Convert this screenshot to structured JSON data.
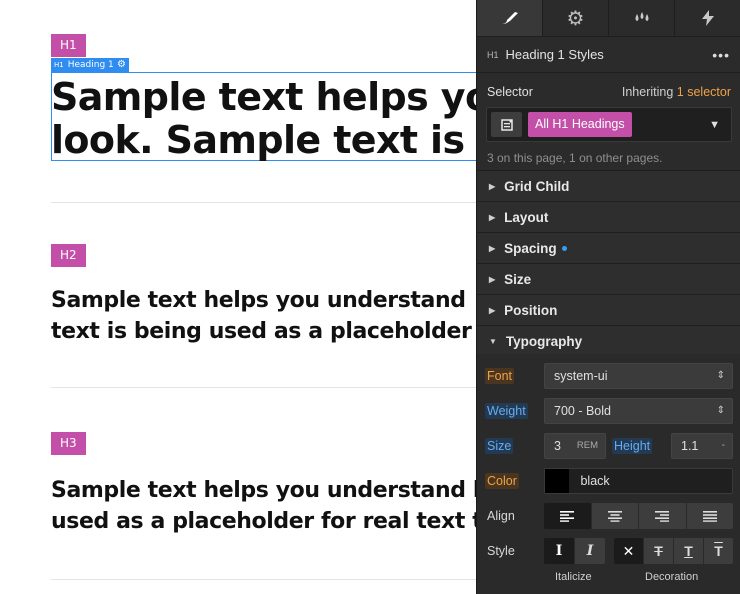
{
  "canvas": {
    "h1_tag": "H1",
    "selection_label": "Heading 1",
    "selection_label_prefix": "H1",
    "h1_line1": "Sample text helps you",
    "h1_line2": "look. Sample text is be",
    "h2_tag": "H2",
    "h2_line1": "Sample text helps you understand",
    "h2_line2": "text is being used as a placeholder",
    "h3_tag": "H3",
    "h3_line1": "Sample text helps you understand ho",
    "h3_line2": "used as a placeholder for real text tha"
  },
  "panel": {
    "tabs": [
      {
        "icon": "brush-icon",
        "active": true
      },
      {
        "icon": "gear-icon",
        "active": false
      },
      {
        "icon": "drops-icon",
        "active": false
      },
      {
        "icon": "lightning-icon",
        "active": false
      }
    ],
    "header": {
      "prefix": "H1",
      "title": "Heading 1 Styles",
      "more": "•••"
    },
    "selector": {
      "label": "Selector",
      "inheriting": "Inheriting",
      "inheriting_count": "1 selector",
      "chip": "All H1 Headings",
      "note": "3 on this page, 1 on other pages."
    },
    "sections": [
      {
        "label": "Grid Child",
        "expanded": false,
        "dot": false
      },
      {
        "label": "Layout",
        "expanded": false,
        "dot": false
      },
      {
        "label": "Spacing",
        "expanded": false,
        "dot": true
      },
      {
        "label": "Size",
        "expanded": false,
        "dot": false
      },
      {
        "label": "Position",
        "expanded": false,
        "dot": false
      },
      {
        "label": "Typography",
        "expanded": true,
        "dot": false
      }
    ],
    "typography": {
      "font_label": "Font",
      "font_value": "system-ui",
      "weight_label": "Weight",
      "weight_value": "700 - Bold",
      "size_label": "Size",
      "size_value": "3",
      "size_unit": "REM",
      "height_label": "Height",
      "height_value": "1.1",
      "height_unit": "-",
      "color_label": "Color",
      "color_value": "black",
      "color_swatch": "#000000",
      "align_label": "Align",
      "style_label": "Style",
      "italicize_caption": "Italicize",
      "decoration_caption": "Decoration"
    },
    "accent_colors": {
      "pink": "#c44fa8",
      "orange": "#f0a246",
      "blue": "#64acf5",
      "selection": "#2f8cf0"
    }
  }
}
